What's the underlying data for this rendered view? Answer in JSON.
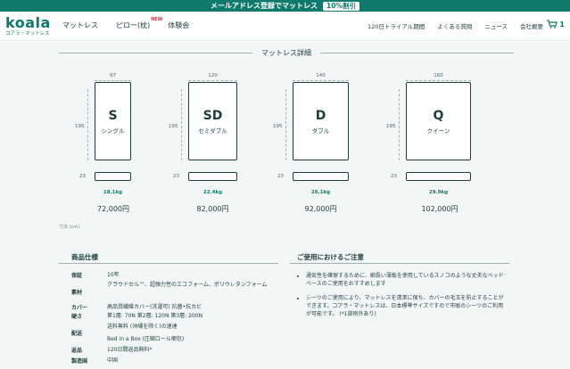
{
  "promo": {
    "text": "メールアドレス登録でマットレス",
    "badge": "10%割引"
  },
  "header": {
    "logo_word": "koala",
    "logo_sub": "コアラ・マットレス",
    "nav_left": [
      {
        "label": "マットレス"
      },
      {
        "label": "ピロー(枕)",
        "badge": "NEW"
      },
      {
        "label": "体験会"
      }
    ],
    "nav_right": [
      "120日トライアル期間",
      "よくある質問",
      "ニュース",
      "会社概要"
    ],
    "cart_count": "1"
  },
  "section_title": "マットレス詳細",
  "sizes": [
    {
      "code": "S",
      "name": "シングル",
      "width": "97",
      "length": "195",
      "height": "23",
      "weight": "18.1kg",
      "price": "72,000円"
    },
    {
      "code": "SD",
      "name": "セミダブル",
      "width": "120",
      "length": "195",
      "height": "23",
      "weight": "22.4kg",
      "price": "82,000円"
    },
    {
      "code": "D",
      "name": "ダブル",
      "width": "140",
      "length": "195",
      "height": "23",
      "weight": "26.1kg",
      "price": "92,000円"
    },
    {
      "code": "Q",
      "name": "クイーン",
      "width": "160",
      "length": "195",
      "height": "23",
      "weight": "29.9kg",
      "price": "102,000円"
    }
  ],
  "unit_note": "寸法 (cm)",
  "specs_title": "商品仕様",
  "specs": [
    {
      "key": "保証",
      "value": "10年"
    },
    {
      "key": "素材",
      "value": "クラウドセル™、超弾力性のエコフォーム、ポリウレタンフォーム"
    },
    {
      "key": "カバー",
      "value": "高品質繊維カバー(洗濯可) 抗菌•抗カビ"
    },
    {
      "key": "硬さ",
      "value": "第1層: 70N 第2層: 120N 第3層: 200N"
    },
    {
      "key": "配送",
      "value": "送料無料 (沖縄を除く)の速達"
    },
    {
      "key": "",
      "value": "Bed in a Box (圧縮ロール梱包)"
    },
    {
      "key": "返品",
      "value": "120日間返品無料*"
    },
    {
      "key": "製造国",
      "value": "中国"
    }
  ],
  "notes_title": "ご使用におけるご注意",
  "notes": [
    "通気性を確保するために、細長い薄板を使用しているスノコのような丈夫なベッドベースのご使用をおすすめします",
    "シーツのご使用により、マットレスを清潔に保ち、カバーの毛玉を防止することができます。コアラ・マットレスは、日本標準サイズですので市販のシーツのご利用が可能です。 (*1部例外あり)"
  ]
}
